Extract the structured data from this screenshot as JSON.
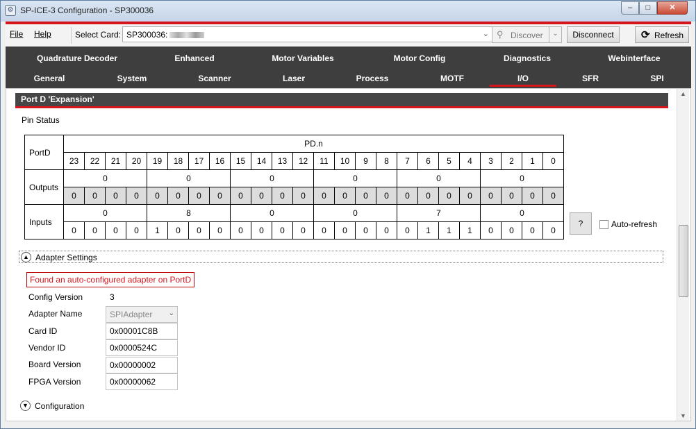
{
  "window": {
    "title": "SP-ICE-3 Configuration - SP300036",
    "min": "–",
    "max": "□",
    "close": "✕"
  },
  "toolbar": {
    "menu_file": "File",
    "menu_help": "Help",
    "select_card_label": "Select Card:",
    "card_value": "SP300036:",
    "discover_label": "Discover",
    "disconnect_label": "Disconnect",
    "refresh_label": "Refresh"
  },
  "tabs": {
    "row1": [
      "Quadrature Decoder",
      "Enhanced",
      "Motor Variables",
      "Motor Config",
      "Diagnostics",
      "Webinterface"
    ],
    "row2": [
      "General",
      "System",
      "Scanner",
      "Laser",
      "Process",
      "MOTF",
      "I/O",
      "SFR",
      "SPI"
    ],
    "active": "I/O"
  },
  "section": {
    "title": "Port D 'Expansion'"
  },
  "pin_status": {
    "label": "Pin Status",
    "port_label": "PortD",
    "header": "PD.n",
    "bit_numbers": [
      "23",
      "22",
      "21",
      "20",
      "19",
      "18",
      "17",
      "16",
      "15",
      "14",
      "13",
      "12",
      "11",
      "10",
      "9",
      "8",
      "7",
      "6",
      "5",
      "4",
      "3",
      "2",
      "1",
      "0"
    ],
    "outputs_label": "Outputs",
    "outputs_nibbles": [
      "0",
      "0",
      "0",
      "0",
      "0",
      "0"
    ],
    "outputs_bits": [
      "0",
      "0",
      "0",
      "0",
      "0",
      "0",
      "0",
      "0",
      "0",
      "0",
      "0",
      "0",
      "0",
      "0",
      "0",
      "0",
      "0",
      "0",
      "0",
      "0",
      "0",
      "0",
      "0",
      "0"
    ],
    "inputs_label": "Inputs",
    "inputs_nibbles": [
      "0",
      "8",
      "0",
      "0",
      "7",
      "0"
    ],
    "inputs_bits": [
      "0",
      "0",
      "0",
      "0",
      "1",
      "0",
      "0",
      "0",
      "0",
      "0",
      "0",
      "0",
      "0",
      "0",
      "0",
      "0",
      "0",
      "1",
      "1",
      "1",
      "0",
      "0",
      "0",
      "0"
    ],
    "help_button": "?",
    "auto_refresh_label": "Auto-refresh"
  },
  "adapter": {
    "expander_label": "Adapter Settings",
    "found_message": "Found an auto-configured adapter on PortD",
    "config_version_label": "Config Version",
    "config_version": "3",
    "adapter_name_label": "Adapter Name",
    "adapter_name": "SPIAdapter",
    "card_id_label": "Card ID",
    "card_id": "0x00001C8B",
    "vendor_id_label": "Vendor ID",
    "vendor_id": "0x0000524C",
    "board_version_label": "Board Version",
    "board_version": "0x00000002",
    "fpga_version_label": "FPGA Version",
    "fpga_version": "0x00000062"
  },
  "configuration": {
    "expander_label": "Configuration"
  },
  "colors": {
    "accent": "#d6141c",
    "tabbar": "#3e3e3e"
  }
}
